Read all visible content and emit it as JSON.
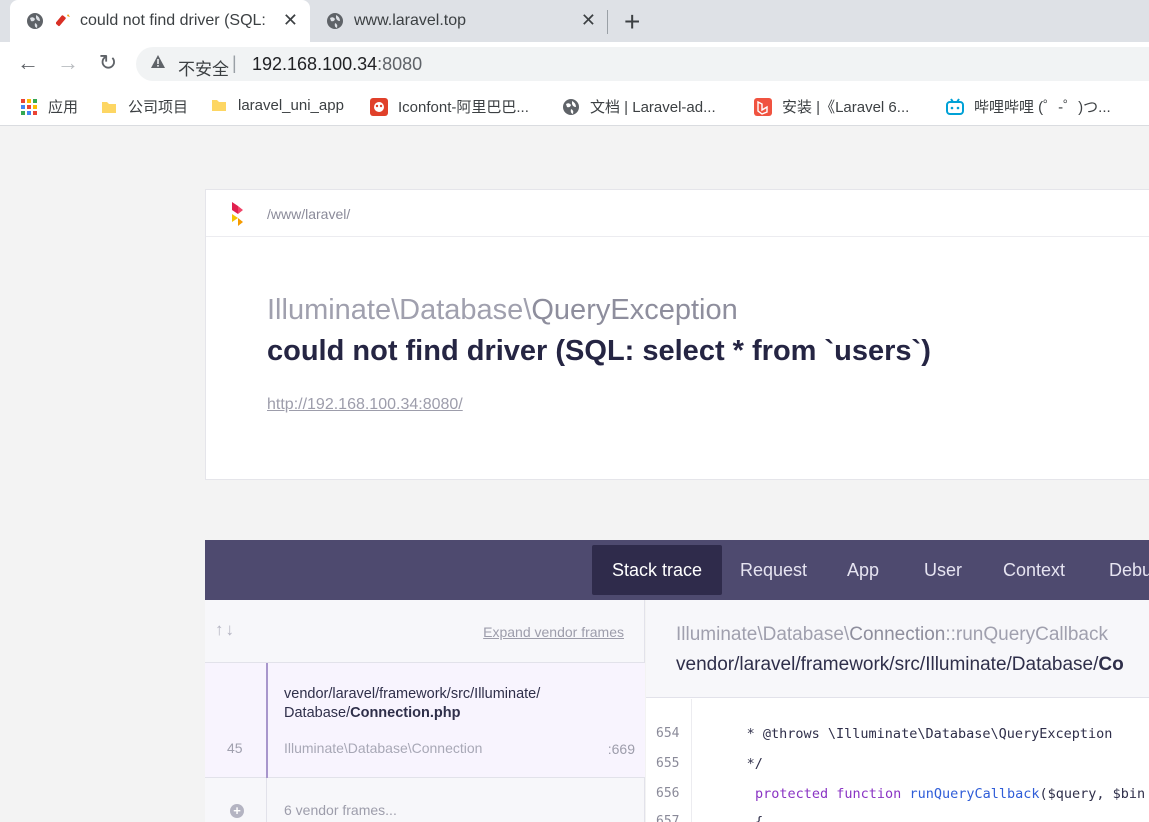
{
  "browser": {
    "tabs": [
      {
        "title": "could not find driver (SQL:",
        "close": "✕"
      },
      {
        "title": "www.laravel.top",
        "close": "✕"
      }
    ],
    "new_tab": "+",
    "omnibox": {
      "insecure": "不安全",
      "separator": "|",
      "host": "192.168.100.34",
      "port": ":8080"
    },
    "bookmarks": [
      {
        "label": "应用",
        "icon": "apps-grid-icon"
      },
      {
        "label": "公司项目",
        "icon": "folder-icon"
      },
      {
        "label": "laravel_uni_app",
        "icon": "folder-icon"
      },
      {
        "label": "Iconfont-阿里巴巴...",
        "icon": "iconfont-icon"
      },
      {
        "label": "文档 | Laravel-ad...",
        "icon": "globe-icon"
      },
      {
        "label": "安装 |《Laravel 6...",
        "icon": "laravel-icon"
      },
      {
        "label": "哔哩哔哩 (゜-゜)つ...",
        "icon": "bilibili-icon"
      }
    ]
  },
  "ignition": {
    "path": "/www/laravel/",
    "exception_namespace": "Illuminate\\Database\\",
    "exception_class": "QueryException",
    "message": "could not find driver (SQL: select * from `users`)",
    "url": "http://192.168.100.34:8080/",
    "tabs": [
      "Stack trace",
      "Request",
      "App",
      "User",
      "Context",
      "Debu"
    ],
    "stack": {
      "expand_label": "Expand vendor frames",
      "frame": {
        "path_prefix": "vendor/laravel/framework/src/Illuminate/",
        "path_dir": "Database/",
        "path_file": "Connection.php",
        "number": "45",
        "class": "Illuminate\\Database\\Connection",
        "line": ":669"
      },
      "vendor_frames": "6 vendor frames..."
    },
    "detail": {
      "namespace": "Illuminate\\Database\\",
      "class": "Connection",
      "method": "::runQueryCallback",
      "file_prefix": "vendor/laravel/framework/src/Illuminate/Database/",
      "file_bold": "Co",
      "lines": [
        {
          "n": "654",
          "text": "     * @throws \\Illuminate\\Database\\QueryException"
        },
        {
          "n": "655",
          "text": "     */"
        },
        {
          "n": "656",
          "kw": "protected function ",
          "fn": "runQueryCallback",
          "rest": "($query, $bin"
        },
        {
          "n": "657",
          "text": "{"
        }
      ]
    }
  }
}
